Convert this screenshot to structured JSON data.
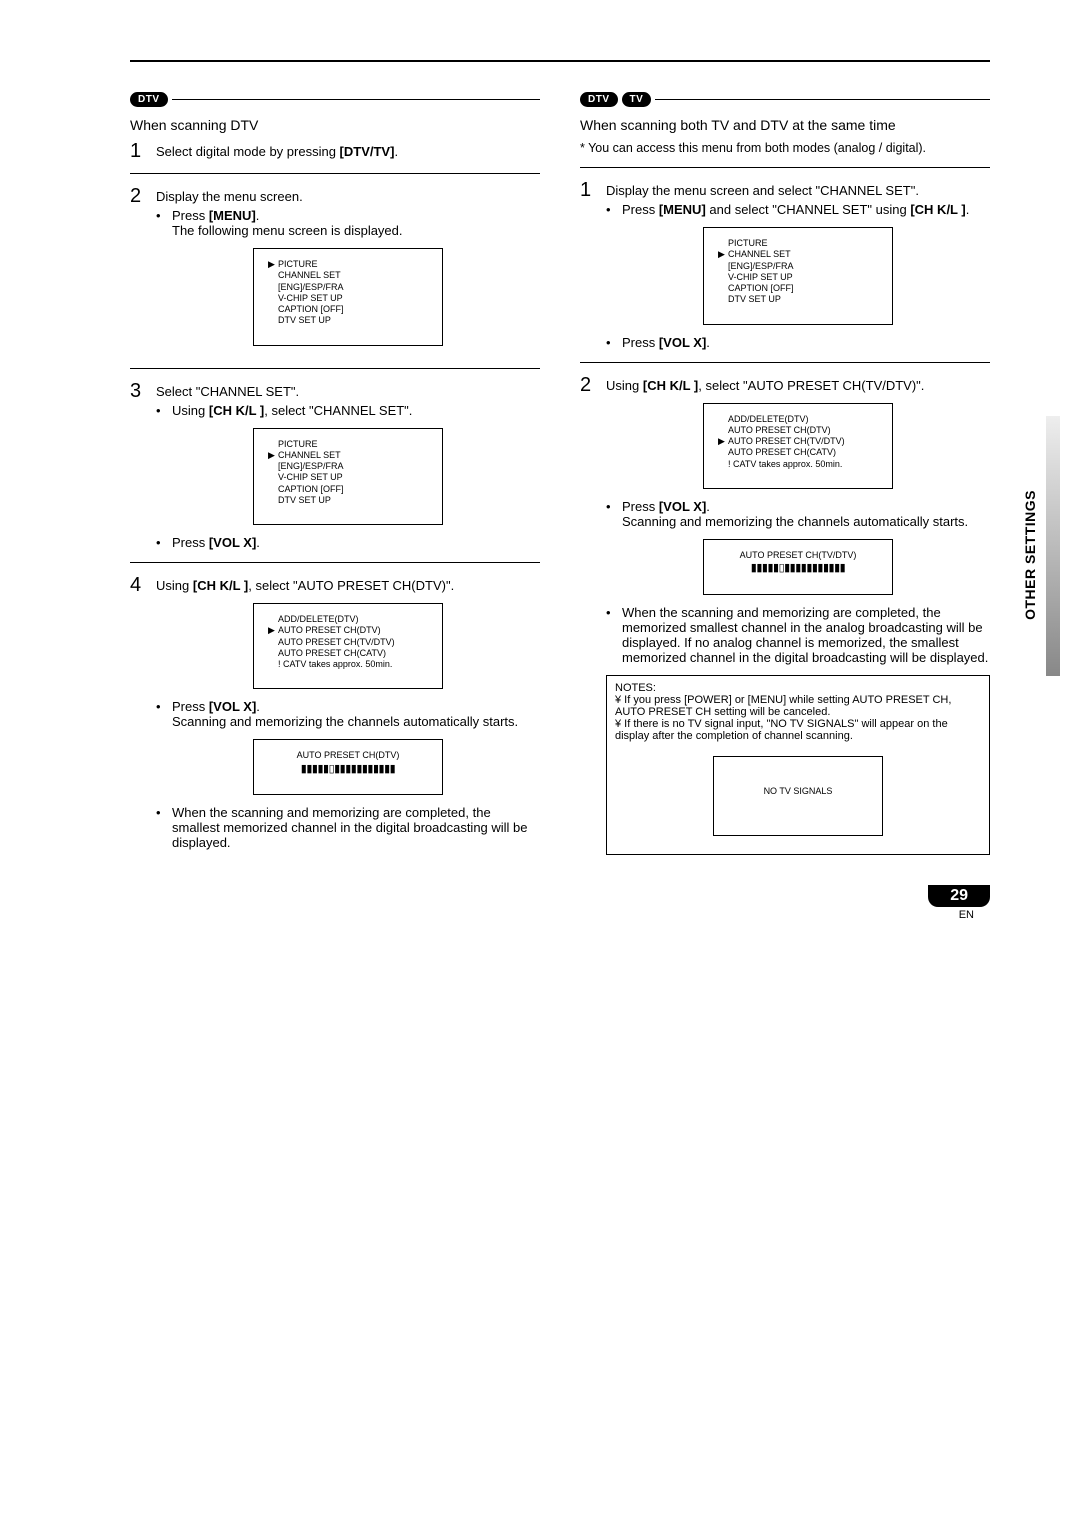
{
  "sideLabel": "OTHER SETTINGS",
  "pageNumber": "29",
  "pageLang": "EN",
  "badges": {
    "dtv": "DTV",
    "tv": "TV"
  },
  "left": {
    "heading": "When scanning DTV",
    "step1": {
      "pre": "Select digital mode by pressing ",
      "btn": "[DTV/TV]",
      "post": "."
    },
    "step2": {
      "line": "Display the menu screen.",
      "b1_pre": "Press ",
      "b1_btn": "[MENU]",
      "b1_post": ".",
      "b1_follow": "The following menu screen is displayed."
    },
    "osd1": {
      "ptrIndex": 0,
      "items": [
        "PICTURE",
        "CHANNEL SET",
        "[ENG]/ESP/FRA",
        "V-CHIP SET UP",
        "CAPTION [OFF]",
        "DTV SET UP"
      ]
    },
    "step3": {
      "line": "Select \"CHANNEL SET\".",
      "b1_pre": "Using ",
      "b1_btn": "[CH K/L ]",
      "b1_post": ", select \"CHANNEL SET\"."
    },
    "osd2": {
      "ptrIndex": 1,
      "items": [
        "PICTURE",
        "CHANNEL SET",
        "[ENG]/ESP/FRA",
        "V-CHIP SET UP",
        "CAPTION [OFF]",
        "DTV SET UP"
      ]
    },
    "step3_b2_pre": "Press ",
    "step3_b2_btn": "[VOL X]",
    "step3_b2_post": ".",
    "step4": {
      "pre": "Using ",
      "btn": "[CH K/L ]",
      "post": ", select \"AUTO PRESET CH(DTV)\"."
    },
    "osd3": {
      "ptrIndex": 1,
      "items": [
        "ADD/DELETE(DTV)",
        "AUTO PRESET CH(DTV)",
        "AUTO PRESET CH(TV/DTV)",
        "AUTO PRESET CH(CATV)",
        "! CATV takes approx. 50min."
      ]
    },
    "step4_b2_pre": "Press ",
    "step4_b2_btn": "[VOL X]",
    "step4_b2_post": ".",
    "step4_follow": "Scanning and memorizing the channels automatically starts.",
    "osd4": {
      "title": "AUTO PRESET CH(DTV)",
      "bar": "▮▮▮▮▮▯▮▮▮▮▮▮▮▮▮▮▮"
    },
    "final": "When the scanning and memorizing are completed, the smallest memorized channel in the digital broadcasting will be displayed."
  },
  "right": {
    "heading": "When scanning both TV and  DTV at the same time",
    "note": "* You can access this menu from both modes (analog / digital).",
    "step1": {
      "line": "Display the menu screen and select \"CHANNEL SET\".",
      "b1_pre": "Press ",
      "b1_btn": "[MENU]",
      "b1_mid": " and select \"CHANNEL SET\" using ",
      "b1_btn2": "[CH K/L ]",
      "b1_post": "."
    },
    "osd1": {
      "ptrIndex": 1,
      "items": [
        "PICTURE",
        "CHANNEL SET",
        "[ENG]/ESP/FRA",
        "V-CHIP SET UP",
        "CAPTION [OFF]",
        "DTV SET UP"
      ]
    },
    "step1_b2_pre": "Press ",
    "step1_b2_btn": "[VOL X]",
    "step1_b2_post": ".",
    "step2": {
      "pre": "Using ",
      "btn": "[CH K/L ]",
      "post": ", select \"AUTO PRESET CH(TV/DTV)\"."
    },
    "osd2": {
      "ptrIndex": 2,
      "items": [
        "ADD/DELETE(DTV)",
        "AUTO PRESET CH(DTV)",
        "AUTO PRESET CH(TV/DTV)",
        "AUTO PRESET CH(CATV)",
        "! CATV takes approx. 50min."
      ]
    },
    "step2_b2_pre": "Press ",
    "step2_b2_btn": "[VOL X]",
    "step2_b2_post": ".",
    "step2_follow": "Scanning and memorizing the channels automatically starts.",
    "osd3": {
      "title": "AUTO PRESET CH(TV/DTV)",
      "bar": "▮▮▮▮▮▯▮▮▮▮▮▮▮▮▮▮▮"
    },
    "final": "When the scanning and memorizing are completed, the memorized smallest channel in the analog broadcasting will be displayed. If no analog channel is memorized, the smallest memorized channel in the digital broadcasting will be displayed.",
    "notes": {
      "title": "NOTES:",
      "n1": "¥ If you press [POWER] or [MENU] while setting AUTO PRESET CH, AUTO PRESET CH setting will be canceled.",
      "n2": "¥ If there is no TV signal input, \"NO TV SIGNALS\" will appear on the display after the completion of channel scanning.",
      "osd": "NO TV SIGNALS"
    }
  }
}
